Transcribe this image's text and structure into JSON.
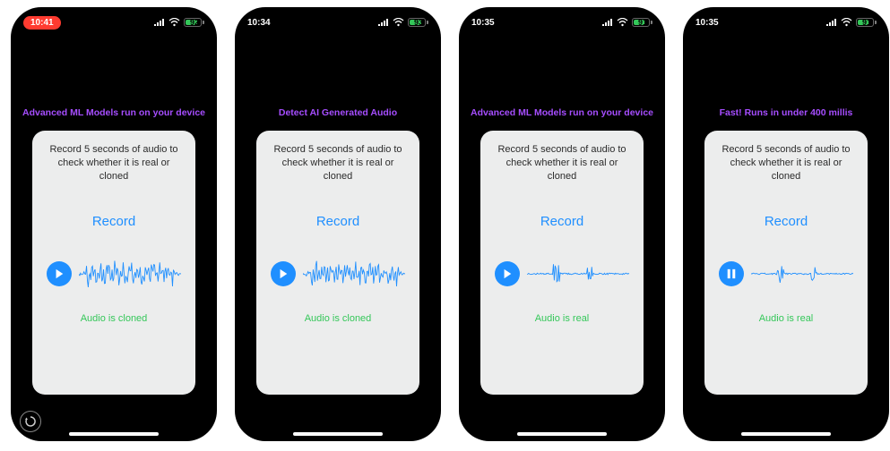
{
  "screens": [
    {
      "time": "10:41",
      "time_style": "pill",
      "battery_pct": "92",
      "headline": "Advanced ML Models run on your device",
      "instruction": "Record 5 seconds of audio to check whether it is real or cloned",
      "record_label": "Record",
      "play_state": "play",
      "wave_variant": "dense",
      "result": "Audio is cloned",
      "show_refresh": true
    },
    {
      "time": "10:34",
      "time_style": "plain",
      "battery_pct": "93",
      "headline": "Detect AI Generated Audio",
      "instruction": "Record 5 seconds of audio to check whether it is real or cloned",
      "record_label": "Record",
      "play_state": "play",
      "wave_variant": "dense",
      "result": "Audio is cloned",
      "show_refresh": false
    },
    {
      "time": "10:35",
      "time_style": "plain",
      "battery_pct": "91",
      "headline": "Advanced ML Models run on your device",
      "instruction": "Record 5 seconds of audio to check whether it is real or cloned",
      "record_label": "Record",
      "play_state": "play",
      "wave_variant": "sparse",
      "result": "Audio is real",
      "show_refresh": false
    },
    {
      "time": "10:35",
      "time_style": "plain",
      "battery_pct": "91",
      "headline": "Fast! Runs in under 400 millis",
      "instruction": "Record 5 seconds of audio to check whether it is real or cloned",
      "record_label": "Record",
      "play_state": "pause",
      "wave_variant": "sparse",
      "result": "Audio is real",
      "show_refresh": false
    }
  ]
}
